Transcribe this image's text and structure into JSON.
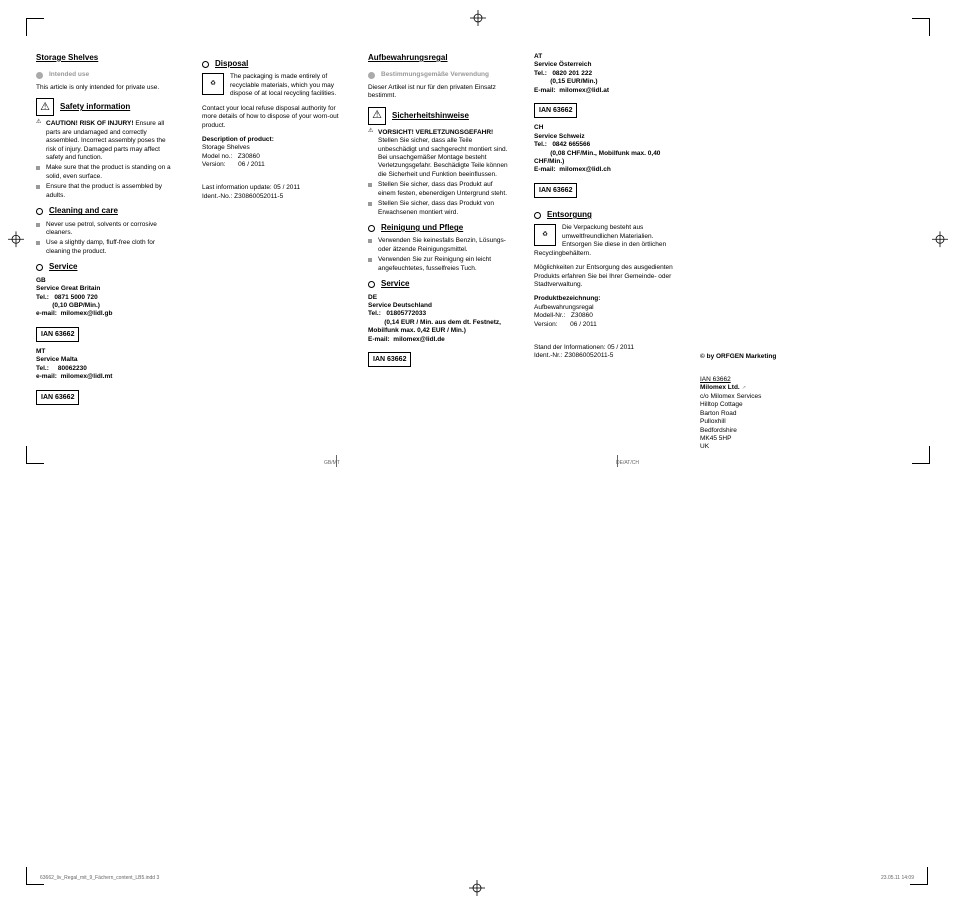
{
  "en": {
    "title": "Storage Shelves",
    "intended": "Intended use",
    "intended_txt": "This article is only intended for private use.",
    "safety": "Safety information",
    "caution": "CAUTION! RISK OF INJURY!",
    "caution_txt": " Ensure all parts are undamaged and correctly assembled. Incorrect assembly poses the risk of injury. Damaged parts may affect safety and function.",
    "s2": "Make sure that the product is standing on a solid, even surface.",
    "s3": "Ensure that the product is assembled by adults.",
    "clean": "Cleaning and care",
    "c1": "Never use petrol, solvents or corrosive cleaners.",
    "c2": "Use a slightly damp, fluff-free cloth for cleaning the product.",
    "service": "Service",
    "gb_head": "GB",
    "gb_name": "Service Great Britain",
    "gb_tel_lbl": "Tel.:",
    "gb_tel": "0871 5000 720",
    "gb_rate": "(0,10 GBP/Min.)",
    "gb_email_lbl": "e-mail:",
    "gb_email": "milomex@lidl.gb",
    "ian": "IAN 63662",
    "mt_head": "MT",
    "mt_name": "Service Malta",
    "mt_tel": "80062230",
    "mt_email": "milomex@lidl.mt",
    "disposal": "Disposal",
    "disp_txt": "The packaging is made entirely of recyclable materials, which you may dispose of at local recycling facilities.",
    "disp_txt2": "Contact your local refuse disposal authority for more details of how to dispose of your worn-out product.",
    "desc": "Description of product:",
    "desc_v": "Storage Shelves",
    "model_lbl": "Model no.:",
    "model_v": "Z30860",
    "ver_lbl": "Version:",
    "ver_v": "06 / 2011",
    "update": "Last information update: 05 / 2011",
    "ident": "Ident.-No.: Z30860052011-5"
  },
  "de": {
    "title": "Aufbewahrungsregal",
    "intended": "Bestimmungsgemäße Verwendung",
    "intended_txt": "Dieser Artikel ist nur für den privaten Einsatz bestimmt.",
    "safety": "Sicherheitshinweise",
    "caution": "VORSICHT! VERLETZUNGSGEFAHR!",
    "caution_txt": " Stellen Sie sicher, dass alle Teile unbeschädigt und sachgerecht montiert sind. Bei unsachgemäßer Montage besteht Verletzungsgefahr. Beschädigte Teile können die Sicherheit und Funktion beeinflussen.",
    "s2": "Stellen Sie sicher, dass das Produkt auf einem festen, ebenerdigen Untergrund steht.",
    "s3": "Stellen Sie sicher, dass das Produkt von Erwachsenen montiert wird.",
    "clean": "Reinigung und Pflege",
    "c1": "Verwenden Sie keinesfalls Benzin, Lösungs- oder ätzende Reinigungsmittel.",
    "c2": "Verwenden Sie zur Reinigung ein leicht angefeuchtetes, fusselfreies Tuch.",
    "service": "Service",
    "de_head": "DE",
    "de_name": "Service Deutschland",
    "de_tel_lbl": "Tel.:",
    "de_tel": "01805772033",
    "de_rate": "(0,14 EUR / Min. aus dem dt. Festnetz, Mobilfunk max. 0,42 EUR / Min.)",
    "de_email_lbl": "E-mail:",
    "de_email": "milomex@lidl.de",
    "ian": "IAN 63662",
    "at_head": "AT",
    "at_name": "Service Österreich",
    "at_tel": "0820 201 222",
    "at_rate": "(0,15 EUR/Min.)",
    "at_email": "milomex@lidl.at",
    "ch_head": "CH",
    "ch_name": "Service Schweiz",
    "ch_tel": "0842 665566",
    "ch_rate": "(0,08 CHF/Min., Mobilfunk max. 0,40 CHF/Min.)",
    "ch_email": "milomex@lidl.ch",
    "disposal": "Entsorgung",
    "disp_txt": "Die Verpackung besteht aus umweltfreundlichen Materialien. Entsorgen Sie diese in den örtlichen Recyclingbehältern.",
    "disp_txt2": "Möglichkeiten zur Entsorgung des ausgedienten Produkts erfahren Sie bei Ihrer Gemeinde- oder Stadtverwaltung.",
    "desc": "Produktbezeichnung:",
    "desc_v": "Aufbewahrungsregal",
    "model_lbl": "Modell-Nr.:",
    "model_v": "Z30860",
    "ver_lbl": "Version:",
    "ver_v": "06 / 2011",
    "update": "Stand der Informationen: 05 / 2011",
    "ident": "Ident.-Nr.: Z30860052011-5"
  },
  "back": {
    "copy": "© by ORFGEN Marketing",
    "ian": "IAN 63662",
    "co": "Milomex Ltd.",
    "l1": "c/o Milomex Services",
    "l2": "Hilltop Cottage",
    "l3": "Barton Road",
    "l4": "Pulloxhill",
    "l5": "Bedfordshire",
    "l6": "MK45 5HP",
    "l7": "UK"
  },
  "footer": {
    "mid1": "GB/MT",
    "mid2": "DE/AT/CH",
    "file": "63662_liv_Regal_mit_9_Fächern_content_LB5.indd   3",
    "date": "23.05.11   14:09"
  }
}
